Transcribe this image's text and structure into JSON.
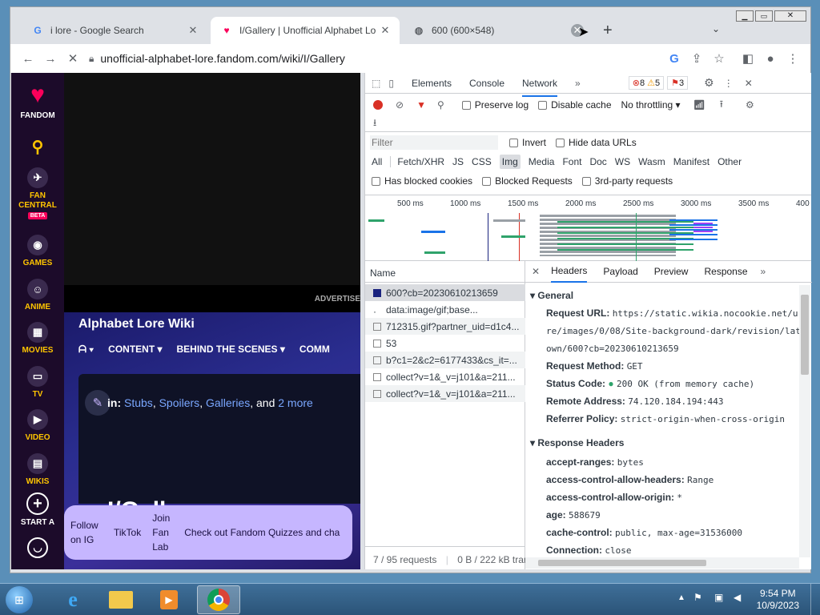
{
  "browser": {
    "tabs": [
      {
        "title": "i lore - Google Search",
        "favicon": "G"
      },
      {
        "title": "I/Gallery | Unofficial Alphabet Lo",
        "favicon": "fandom"
      },
      {
        "title": "600 (600×548)",
        "favicon": "globe"
      }
    ],
    "url": "unofficial-alphabet-lore.fandom.com/wiki/I/Gallery"
  },
  "page": {
    "sidebar": {
      "fandom": "FANDOM",
      "fan_central": "FAN CENTRAL",
      "beta": "BETA",
      "games": "GAMES",
      "anime": "ANIME",
      "movies": "MOVIES",
      "tv": "TV",
      "video": "VIDEO",
      "wikis": "WIKIS",
      "start": "START A"
    },
    "advert": "ADVERTISE",
    "wiki_title": "Alphabet Lore Wiki",
    "nav": [
      "CONTENT",
      "BEHIND THE SCENES",
      "COMM"
    ],
    "cats_prefix": "in:",
    "cats": [
      "Stubs",
      "Spoilers",
      "Galleries"
    ],
    "cats_and": ", and",
    "cats_more": "2 more",
    "page_title": "I/Gallery",
    "follow": [
      "Follow on IG",
      "TikTok",
      "Join Fan Lab",
      "Check out Fandom Quizzes and cha"
    ]
  },
  "devtools": {
    "tabs": [
      "Elements",
      "Console",
      "Network"
    ],
    "errors": "8",
    "warnings": "5",
    "issues": "3",
    "preserve_log": "Preserve log",
    "disable_cache": "Disable cache",
    "throttling": "No throttling",
    "filter_placeholder": "Filter",
    "invert": "Invert",
    "hide_data": "Hide data URLs",
    "types": [
      "All",
      "Fetch/XHR",
      "JS",
      "CSS",
      "Img",
      "Media",
      "Font",
      "Doc",
      "WS",
      "Wasm",
      "Manifest",
      "Other"
    ],
    "blocked_cookies": "Has blocked cookies",
    "blocked_requests": "Blocked Requests",
    "third_party": "3rd-party requests",
    "ticks": [
      "500 ms",
      "1000 ms",
      "1500 ms",
      "2000 ms",
      "2500 ms",
      "3000 ms",
      "3500 ms",
      "400"
    ],
    "name_header": "Name",
    "requests": [
      "600?cb=20230610213659",
      "data:image/gif;base...",
      "712315.gif?partner_uid=d1c4...",
      "53",
      "b?c1=2&c2=6177433&cs_it=...",
      "collect?v=1&_v=j101&a=211...",
      "collect?v=1&_v=j101&a=211..."
    ],
    "detail_tabs": [
      "Headers",
      "Payload",
      "Preview",
      "Response"
    ],
    "general": "General",
    "request_url_label": "Request URL:",
    "request_url_1": "https://static.wikia.nocookie.net/u",
    "request_url_2": "re/images/0/08/Site-background-dark/revision/lat",
    "request_url_3": "own/600?cb=20230610213659",
    "method_label": "Request Method:",
    "method": "GET",
    "status_label": "Status Code:",
    "status": "200 OK (from memory cache)",
    "remote_label": "Remote Address:",
    "remote": "74.120.184.194:443",
    "referrer_label": "Referrer Policy:",
    "referrer": "strict-origin-when-cross-origin",
    "response_headers": "Response Headers",
    "headers": [
      {
        "k": "accept-ranges:",
        "v": "bytes"
      },
      {
        "k": "access-control-allow-headers:",
        "v": "Range"
      },
      {
        "k": "access-control-allow-origin:",
        "v": "*"
      },
      {
        "k": "age:",
        "v": "588679"
      },
      {
        "k": "cache-control:",
        "v": "public, max-age=31536000"
      },
      {
        "k": "Connection:",
        "v": "close"
      }
    ],
    "footer_requests": "7 / 95 requests",
    "footer_transfer": "0 B / 222 kB tran"
  },
  "taskbar": {
    "time": "9:54 PM",
    "date": "10/9/2023"
  },
  "colors": {
    "accent": "#1a73e8",
    "fandom": "#fa005a",
    "record": "#d93025"
  }
}
